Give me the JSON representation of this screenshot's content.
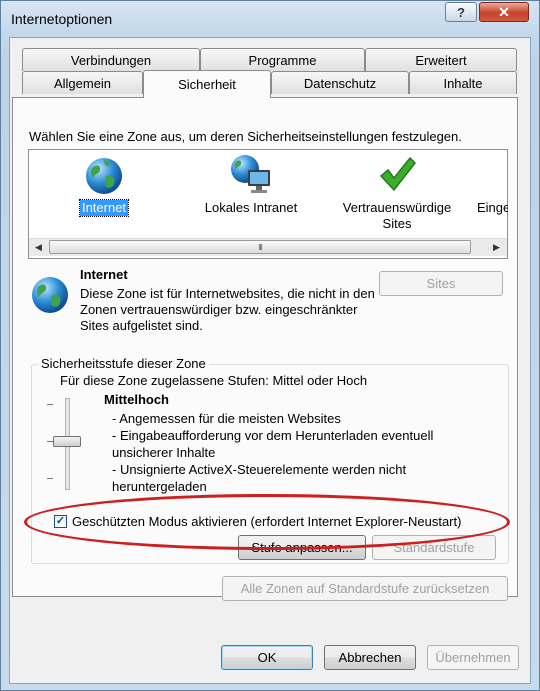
{
  "window": {
    "title": "Internetoptionen",
    "help_glyph": "?",
    "close_glyph": "✕"
  },
  "tabs": {
    "row1": [
      "Verbindungen",
      "Programme",
      "Erweitert"
    ],
    "row2": [
      "Allgemein",
      "Sicherheit",
      "Datenschutz",
      "Inhalte"
    ],
    "active": "Sicherheit"
  },
  "security": {
    "intro": "Wählen Sie eine Zone aus, um deren Sicherheitseinstellungen festzulegen.",
    "zones": [
      {
        "label": "Internet",
        "icon": "globe-icon",
        "selected": true
      },
      {
        "label": "Lokales Intranet",
        "icon": "intranet-icon",
        "selected": false
      },
      {
        "label": "Vertrauenswürdige Sites",
        "icon": "checkmark-icon",
        "selected": false
      },
      {
        "label": "Einge",
        "icon": "restricted-icon",
        "selected": false
      }
    ],
    "scroll_grip": "III",
    "zone_title": "Internet",
    "zone_description": "Diese Zone ist für Internetwebsites, die nicht in den Zonen vertrauenswürdiger bzw. eingeschränkter Sites aufgelistet sind.",
    "sites_button": "Sites",
    "level_group": {
      "legend": "Sicherheitsstufe dieser Zone",
      "allowed": "Für diese Zone zugelassene Stufen: Mittel oder Hoch",
      "level_name": "Mittelhoch",
      "bullets": [
        "- Angemessen für die meisten Websites",
        "- Eingabeaufforderung vor dem Herunterladen eventuell unsicherer Inhalte",
        "- Unsignierte ActiveX-Steuerelemente werden nicht heruntergeladen"
      ],
      "protected_mode_label": "Geschützten Modus aktivieren (erfordert Internet Explorer-Neustart)",
      "protected_mode_checked": true,
      "custom_level_button": "Stufe anpassen...",
      "default_level_button": "Standardstufe"
    },
    "reset_all_button": "Alle Zonen auf Standardstufe zurücksetzen"
  },
  "footer": {
    "ok": "OK",
    "cancel": "Abbrechen",
    "apply": "Übernehmen"
  },
  "colors": {
    "annotation_ellipse": "#cc1f1f",
    "selection": "#3399ff"
  }
}
